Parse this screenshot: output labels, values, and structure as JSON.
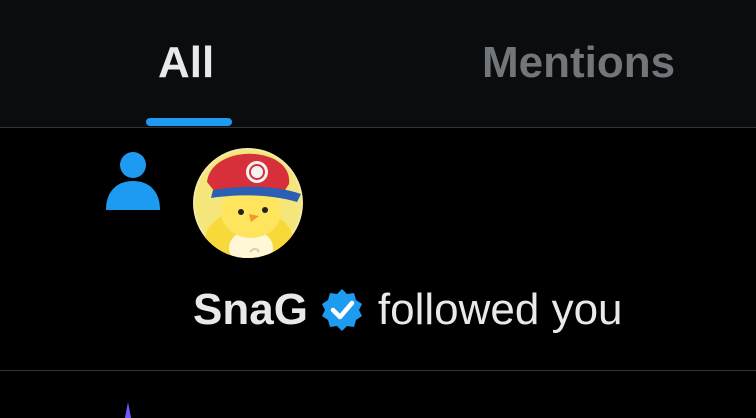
{
  "colors": {
    "accent": "#1d9bf0",
    "active_text": "#e7e9ea",
    "inactive_text": "#71767b",
    "background": "#000000",
    "next_icon": "#7856ff"
  },
  "tabs": [
    {
      "label": "All",
      "selected": true
    },
    {
      "label": "Mentions",
      "selected": false
    }
  ],
  "notifications": [
    {
      "type_icon": "person-icon",
      "avatar": "cartoon-penguin-avatar",
      "user_name": "SnaG",
      "verified": true,
      "action": "followed you"
    }
  ],
  "next_item_icon": "purple-sparkle-icon"
}
